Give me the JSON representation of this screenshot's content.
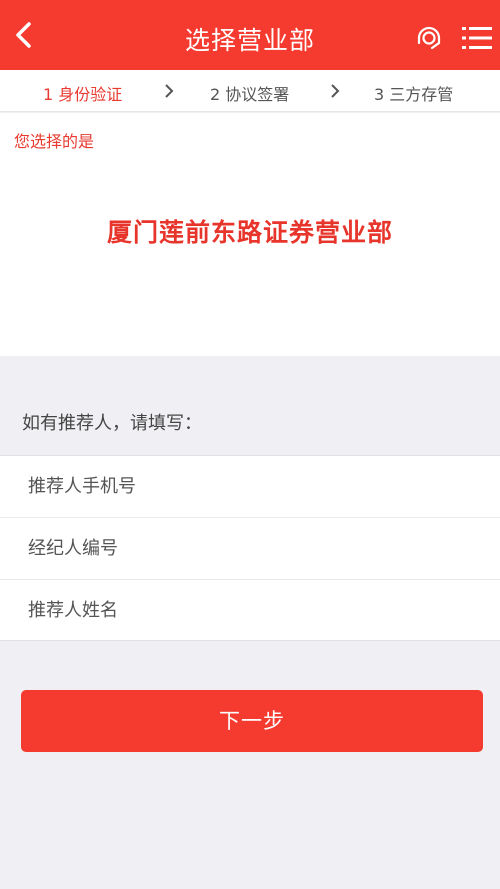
{
  "colors": {
    "brand": "#f53b2f",
    "accent_text": "#e83a30",
    "background": "#f0f0f4"
  },
  "header": {
    "title": "选择营业部",
    "back_icon": "chevron-left-icon",
    "service_icon": "customer-service-icon",
    "menu_icon": "menu-icon"
  },
  "steps": [
    {
      "label": "1 身份验证",
      "active": true
    },
    {
      "label": "2 协议签署",
      "active": false
    },
    {
      "label": "3 三方存管",
      "active": false
    }
  ],
  "selection": {
    "label": "您选择的是",
    "branch_name": "厦门莲前东路证券营业部"
  },
  "referral": {
    "hint": "如有推荐人，请填写：",
    "fields": [
      {
        "placeholder": "推荐人手机号",
        "value": ""
      },
      {
        "placeholder": "经纪人编号",
        "value": ""
      },
      {
        "placeholder": "推荐人姓名",
        "value": ""
      }
    ]
  },
  "next_button": {
    "label": "下一步"
  }
}
